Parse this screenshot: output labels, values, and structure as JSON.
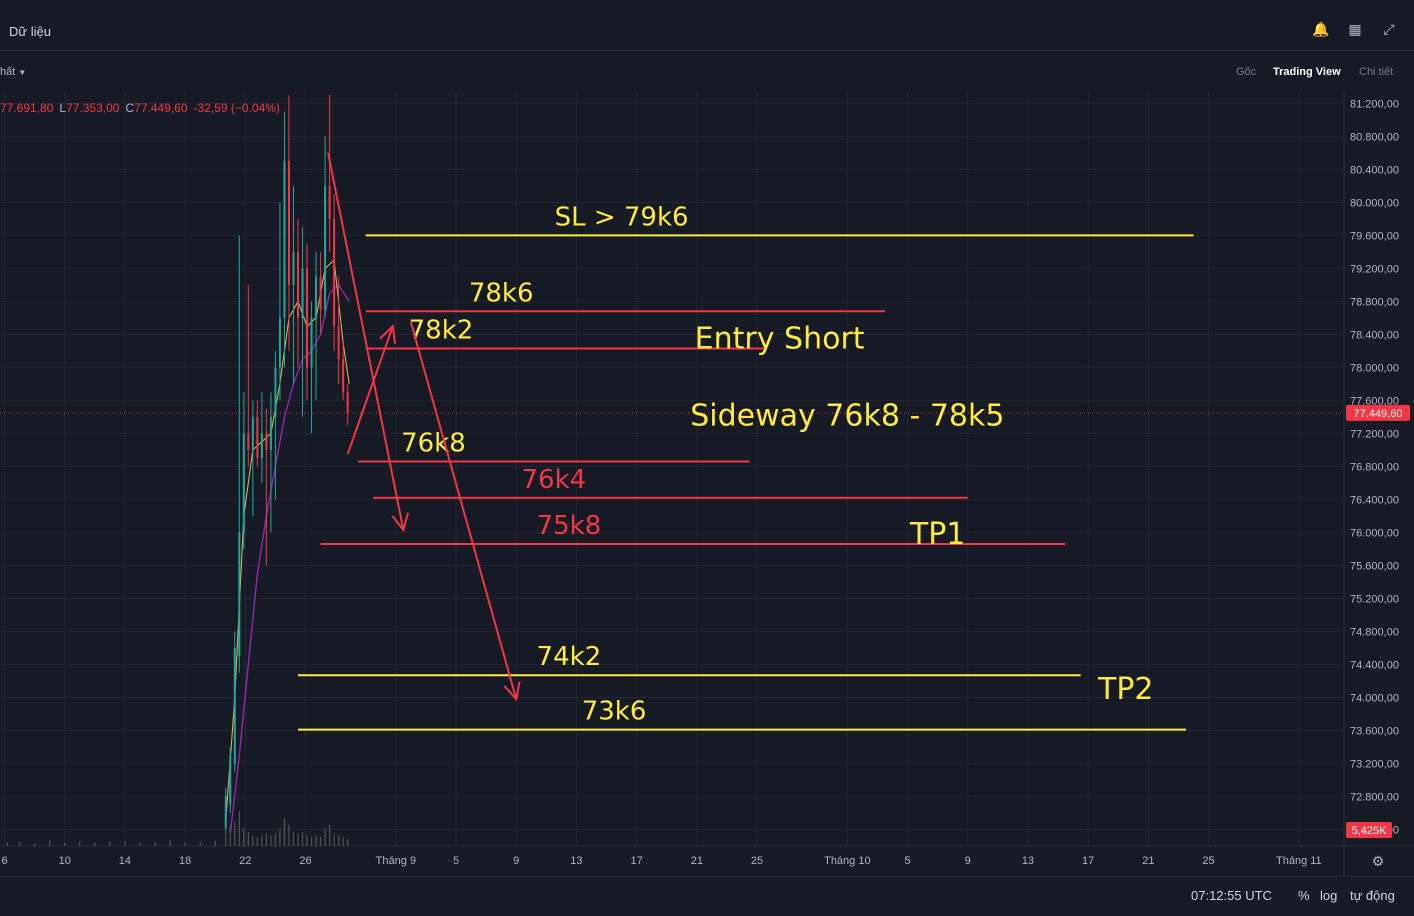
{
  "header": {
    "title": "Dữ liệu",
    "left_dropdown": "hất",
    "views": [
      "Gốc",
      "Trading View",
      "Chi tiết"
    ],
    "active_view": "Trading View",
    "icons": [
      "bell-icon",
      "grid-icon",
      "collapse-icon"
    ]
  },
  "ohlc": {
    "high": "77.691,80",
    "low_label": "L",
    "low": "77.353,00",
    "close_label": "C",
    "close": "77.449,60",
    "change": "-32,59 (−0.04%)"
  },
  "colors": {
    "background": "#161a25",
    "grid": "#222631",
    "yellow": "#ffeb3b",
    "red": "#f23645",
    "up": "#26a69a",
    "ma_yellow": "#e0c060",
    "ma_purple": "#9c27b0"
  },
  "footer": {
    "time": "07:12:55 UTC",
    "percent": "%",
    "log": "log",
    "auto": "tự động"
  },
  "chart_data": {
    "type": "line",
    "ylim": [
      72200,
      81350
    ],
    "y_ticks": [
      "81.200,00",
      "80.800,00",
      "80.400,00",
      "80.000,00",
      "79.600,00",
      "79.200,00",
      "78.800,00",
      "78.400,00",
      "78.000,00",
      "77.600,00",
      "77.200,00",
      "76.800,00",
      "76.400,00",
      "76.000,00",
      "75.600,00",
      "75.200,00",
      "74.800,00",
      "74.400,00",
      "74.000,00",
      "73.600,00",
      "73.200,00",
      "72.800,00",
      "72.400,00"
    ],
    "y_tick_values": [
      81200,
      80800,
      80400,
      80000,
      79600,
      79200,
      78800,
      78400,
      78000,
      77600,
      77200,
      76800,
      76400,
      76000,
      75600,
      75200,
      74800,
      74400,
      74000,
      73600,
      73200,
      72800,
      72400
    ],
    "x_ticks": [
      "6",
      "10",
      "14",
      "18",
      "22",
      "26",
      "Tháng 9",
      "5",
      "9",
      "13",
      "17",
      "21",
      "25",
      "Tháng 10",
      "5",
      "9",
      "13",
      "17",
      "21",
      "25",
      "Tháng 11"
    ],
    "x_tick_days": [
      6,
      10,
      14,
      18,
      22,
      26,
      32,
      36,
      40,
      44,
      48,
      52,
      56,
      62,
      66,
      70,
      74,
      78,
      82,
      86,
      92
    ],
    "x_range_days": [
      5.7,
      95
    ],
    "current_price": 77449.6,
    "current_price_label": "77.449,60",
    "volume_label": "5,425K",
    "levels": [
      {
        "name": "sl",
        "value": 79600,
        "color": "yellow",
        "from": 30,
        "to": 85,
        "label": "SL > 79k6",
        "label_color": "yellow",
        "label_day": 47,
        "label_dy": -24
      },
      {
        "name": "78k6",
        "value": 78680,
        "color": "red",
        "from": 30,
        "to": 64.5,
        "label": "78k6",
        "label_color": "yellow",
        "label_day": 39,
        "label_dy": -24
      },
      {
        "name": "78k2",
        "value": 78230,
        "color": "red",
        "from": 30,
        "to": 56.5,
        "label": "78k2",
        "label_color": "yellow",
        "label_day": 35,
        "label_dy": -24
      },
      {
        "name": "76k8",
        "value": 76860,
        "color": "red",
        "from": 29.5,
        "to": 55.5,
        "label": "76k8",
        "label_color": "yellow",
        "label_day": 34.5,
        "label_dy": -24
      },
      {
        "name": "76k4",
        "value": 76420,
        "color": "red",
        "from": 30.5,
        "to": 70,
        "label": "76k4",
        "label_color": "red",
        "label_day": 42.5,
        "label_dy": -24
      },
      {
        "name": "75k8",
        "value": 75860,
        "color": "red",
        "from": 27,
        "to": 76.5,
        "label": "75k8",
        "label_color": "red",
        "label_day": 43.5,
        "label_dy": -24
      },
      {
        "name": "74k2",
        "value": 74270,
        "color": "yellow",
        "from": 25.5,
        "to": 77.5,
        "label": "74k2",
        "label_color": "yellow",
        "label_day": 43.5,
        "label_dy": -24
      },
      {
        "name": "73k6",
        "value": 73610,
        "color": "yellow",
        "from": 25.5,
        "to": 84.5,
        "label": "73k6",
        "label_color": "yellow",
        "label_day": 46.5,
        "label_dy": -24
      }
    ],
    "annotations": [
      {
        "text": "Entry Short",
        "day": 57.5,
        "value": 78350,
        "color": "yellow",
        "size": 30
      },
      {
        "text": "Sideway 76k8 - 78k5",
        "day": 62,
        "value": 77420,
        "color": "yellow",
        "size": 30
      },
      {
        "text": "TP1",
        "day": 68,
        "value": 75980,
        "color": "yellow",
        "size": 30
      },
      {
        "text": "TP2",
        "day": 80.5,
        "value": 74100,
        "color": "yellow",
        "size": 30
      }
    ],
    "arrows": [
      {
        "points": [
          [
            27.5,
            80.6
          ],
          [
            32.5,
            76.03
          ]
        ]
      },
      {
        "points": [
          [
            28.8,
            76.95
          ],
          [
            31.8,
            78.5
          ]
        ]
      },
      {
        "points": [
          [
            33,
            78.55
          ],
          [
            40,
            73.98
          ]
        ]
      }
    ],
    "candles": [
      {
        "d": 20.7,
        "o": 72420,
        "h": 72900,
        "l": 72400,
        "c": 72800
      },
      {
        "d": 21.0,
        "o": 72700,
        "h": 73400,
        "l": 72600,
        "c": 73300
      },
      {
        "d": 21.3,
        "o": 73200,
        "h": 74800,
        "l": 73100,
        "c": 74600
      },
      {
        "d": 21.6,
        "o": 74500,
        "h": 79600,
        "l": 74300,
        "c": 76000
      },
      {
        "d": 21.9,
        "o": 76000,
        "h": 77700,
        "l": 75800,
        "c": 77200
      },
      {
        "d": 22.2,
        "o": 77200,
        "h": 79000,
        "l": 76800,
        "c": 77000
      },
      {
        "d": 22.5,
        "o": 77000,
        "h": 77600,
        "l": 76200,
        "c": 77400
      },
      {
        "d": 22.8,
        "o": 77400,
        "h": 77600,
        "l": 76800,
        "c": 76900
      },
      {
        "d": 23.1,
        "o": 76900,
        "h": 77700,
        "l": 76600,
        "c": 77200
      },
      {
        "d": 23.4,
        "o": 77200,
        "h": 77500,
        "l": 75600,
        "c": 77000
      },
      {
        "d": 23.7,
        "o": 77000,
        "h": 77700,
        "l": 76000,
        "c": 77400
      },
      {
        "d": 24.0,
        "o": 77400,
        "h": 78200,
        "l": 76400,
        "c": 78000
      },
      {
        "d": 24.3,
        "o": 78000,
        "h": 80000,
        "l": 77600,
        "c": 78600
      },
      {
        "d": 24.6,
        "o": 78600,
        "h": 81100,
        "l": 78000,
        "c": 80500
      },
      {
        "d": 24.9,
        "o": 80500,
        "h": 81300,
        "l": 78200,
        "c": 79000
      },
      {
        "d": 25.2,
        "o": 79000,
        "h": 80200,
        "l": 77800,
        "c": 79400
      },
      {
        "d": 25.5,
        "o": 79400,
        "h": 79800,
        "l": 78000,
        "c": 78600
      },
      {
        "d": 25.8,
        "o": 78600,
        "h": 79700,
        "l": 77400,
        "c": 79200
      },
      {
        "d": 26.1,
        "o": 79200,
        "h": 79500,
        "l": 77600,
        "c": 78000
      },
      {
        "d": 26.4,
        "o": 78000,
        "h": 78800,
        "l": 77200,
        "c": 78600
      },
      {
        "d": 26.7,
        "o": 78600,
        "h": 79400,
        "l": 77600,
        "c": 79100
      },
      {
        "d": 27.0,
        "o": 79100,
        "h": 79400,
        "l": 78400,
        "c": 78700
      },
      {
        "d": 27.3,
        "o": 78700,
        "h": 80800,
        "l": 78600,
        "c": 80200
      },
      {
        "d": 27.6,
        "o": 80200,
        "h": 81300,
        "l": 79400,
        "c": 79800
      },
      {
        "d": 27.9,
        "o": 79800,
        "h": 80100,
        "l": 78200,
        "c": 78500
      },
      {
        "d": 28.2,
        "o": 78500,
        "h": 79100,
        "l": 77800,
        "c": 78100
      },
      {
        "d": 28.5,
        "o": 78100,
        "h": 78300,
        "l": 77600,
        "c": 77700
      },
      {
        "d": 28.8,
        "o": 77700,
        "h": 77800,
        "l": 77300,
        "c": 77450
      }
    ],
    "ma_fast": [
      [
        20.7,
        72500
      ],
      [
        21.3,
        74000
      ],
      [
        21.9,
        76200
      ],
      [
        22.5,
        77000
      ],
      [
        23.1,
        77100
      ],
      [
        23.7,
        77200
      ],
      [
        24.3,
        77800
      ],
      [
        24.9,
        78600
      ],
      [
        25.5,
        78800
      ],
      [
        26.1,
        78500
      ],
      [
        26.7,
        78600
      ],
      [
        27.3,
        79200
      ],
      [
        27.9,
        79300
      ],
      [
        28.5,
        78300
      ],
      [
        28.9,
        77800
      ]
    ],
    "ma_slow": [
      [
        21.0,
        72350
      ],
      [
        21.6,
        73300
      ],
      [
        22.2,
        74400
      ],
      [
        22.8,
        75500
      ],
      [
        23.4,
        76200
      ],
      [
        24.0,
        76800
      ],
      [
        24.6,
        77400
      ],
      [
        25.2,
        77800
      ],
      [
        25.8,
        78100
      ],
      [
        26.4,
        78200
      ],
      [
        27.0,
        78400
      ],
      [
        27.6,
        78900
      ],
      [
        28.2,
        79000
      ],
      [
        28.9,
        78800
      ]
    ],
    "volume": [
      {
        "d": 6.2,
        "v": 0.1
      },
      {
        "d": 7,
        "v": 0.12
      },
      {
        "d": 8,
        "v": 0.08
      },
      {
        "d": 9,
        "v": 0.15
      },
      {
        "d": 10,
        "v": 0.1
      },
      {
        "d": 11,
        "v": 0.13
      },
      {
        "d": 12,
        "v": 0.09
      },
      {
        "d": 13,
        "v": 0.12
      },
      {
        "d": 14,
        "v": 0.14
      },
      {
        "d": 15,
        "v": 0.1
      },
      {
        "d": 16,
        "v": 0.11
      },
      {
        "d": 17,
        "v": 0.16
      },
      {
        "d": 18,
        "v": 0.1
      },
      {
        "d": 19,
        "v": 0.12
      },
      {
        "d": 20,
        "v": 0.15
      },
      {
        "d": 20.7,
        "v": 0.9
      },
      {
        "d": 21.0,
        "v": 0.6
      },
      {
        "d": 21.3,
        "v": 0.7
      },
      {
        "d": 21.6,
        "v": 1.0
      },
      {
        "d": 21.9,
        "v": 0.5
      },
      {
        "d": 22.2,
        "v": 0.4
      },
      {
        "d": 22.5,
        "v": 0.3
      },
      {
        "d": 22.8,
        "v": 0.25
      },
      {
        "d": 23.1,
        "v": 0.3
      },
      {
        "d": 23.4,
        "v": 0.35
      },
      {
        "d": 23.7,
        "v": 0.3
      },
      {
        "d": 24.0,
        "v": 0.35
      },
      {
        "d": 24.3,
        "v": 0.5
      },
      {
        "d": 24.6,
        "v": 0.8
      },
      {
        "d": 24.9,
        "v": 0.6
      },
      {
        "d": 25.2,
        "v": 0.4
      },
      {
        "d": 25.5,
        "v": 0.35
      },
      {
        "d": 25.8,
        "v": 0.4
      },
      {
        "d": 26.1,
        "v": 0.3
      },
      {
        "d": 26.4,
        "v": 0.25
      },
      {
        "d": 26.7,
        "v": 0.3
      },
      {
        "d": 27.0,
        "v": 0.25
      },
      {
        "d": 27.3,
        "v": 0.5
      },
      {
        "d": 27.6,
        "v": 0.6
      },
      {
        "d": 27.9,
        "v": 0.35
      },
      {
        "d": 28.2,
        "v": 0.3
      },
      {
        "d": 28.5,
        "v": 0.25
      },
      {
        "d": 28.8,
        "v": 0.2
      }
    ]
  }
}
